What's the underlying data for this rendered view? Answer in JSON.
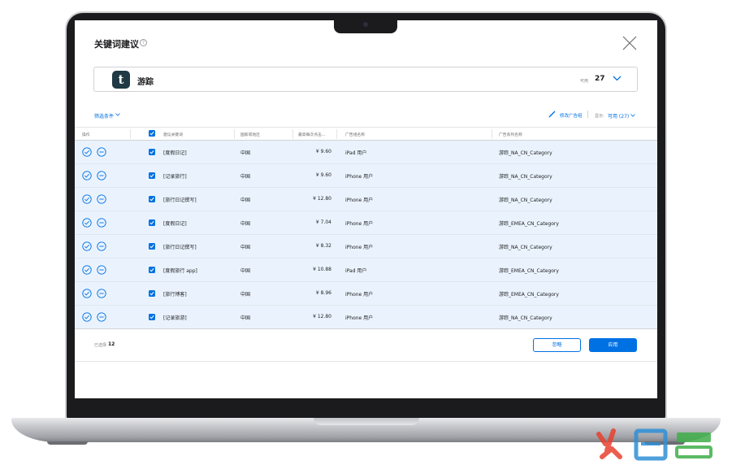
{
  "dialog": {
    "title": "关键词建议",
    "help_icon": "question-circle-icon",
    "close_icon": "close-x-icon"
  },
  "app": {
    "icon_letter": "t",
    "name": "游踪",
    "available_label": "可用",
    "available_count": "27"
  },
  "toolbar": {
    "filter_label": "筛选条件",
    "edit_ad_group_label": "修改广告组",
    "show_label": "显示:",
    "show_value": "可用 (27)"
  },
  "table": {
    "headers": [
      "操作",
      "建议关键词",
      "国家或地区",
      "最高每次点击...",
      "广告组名称",
      "广告系列名称"
    ],
    "rows": [
      {
        "keyword": "[度假日记]",
        "region": "中国",
        "bid": "¥ 9.60",
        "ad_group": "iPad 用户",
        "campaign": "游踪_NA_CN_Category"
      },
      {
        "keyword": "[记录旅行]",
        "region": "中国",
        "bid": "¥ 9.60",
        "ad_group": "iPhone 用户",
        "campaign": "游踪_NA_CN_Category"
      },
      {
        "keyword": "[旅行日记撰写]",
        "region": "中国",
        "bid": "¥ 12.80",
        "ad_group": "iPhone 用户",
        "campaign": "游踪_NA_CN_Category"
      },
      {
        "keyword": "[度假日记]",
        "region": "中国",
        "bid": "¥ 7.04",
        "ad_group": "iPhone 用户",
        "campaign": "游踪_EMEA_CN_Category"
      },
      {
        "keyword": "[旅行日记撰写]",
        "region": "中国",
        "bid": "¥ 8.32",
        "ad_group": "iPhone 用户",
        "campaign": "游踪_NA_CN_Category"
      },
      {
        "keyword": "[度假旅行 app]",
        "region": "中国",
        "bid": "¥ 10.88",
        "ad_group": "iPad 用户",
        "campaign": "游踪_EMEA_CN_Category"
      },
      {
        "keyword": "[旅行博客]",
        "region": "中国",
        "bid": "¥ 8.96",
        "ad_group": "iPhone 用户",
        "campaign": "游踪_EMEA_CN_Category"
      },
      {
        "keyword": "[记录旅游]",
        "region": "中国",
        "bid": "¥ 12.80",
        "ad_group": "iPhone 用户",
        "campaign": "游踪_NA_CN_Category"
      }
    ]
  },
  "footer": {
    "selected_label": "已选择",
    "selected_count": "12",
    "ignore_label": "忽略",
    "apply_label": "应用"
  },
  "colors": {
    "accent": "#0071e3",
    "row_highlight": "#eaf3fd",
    "app_icon_bg": "#1f3945",
    "watermark_red": "#e8412f",
    "watermark_blue": "#2e8fd6",
    "watermark_green": "#3fae49"
  }
}
